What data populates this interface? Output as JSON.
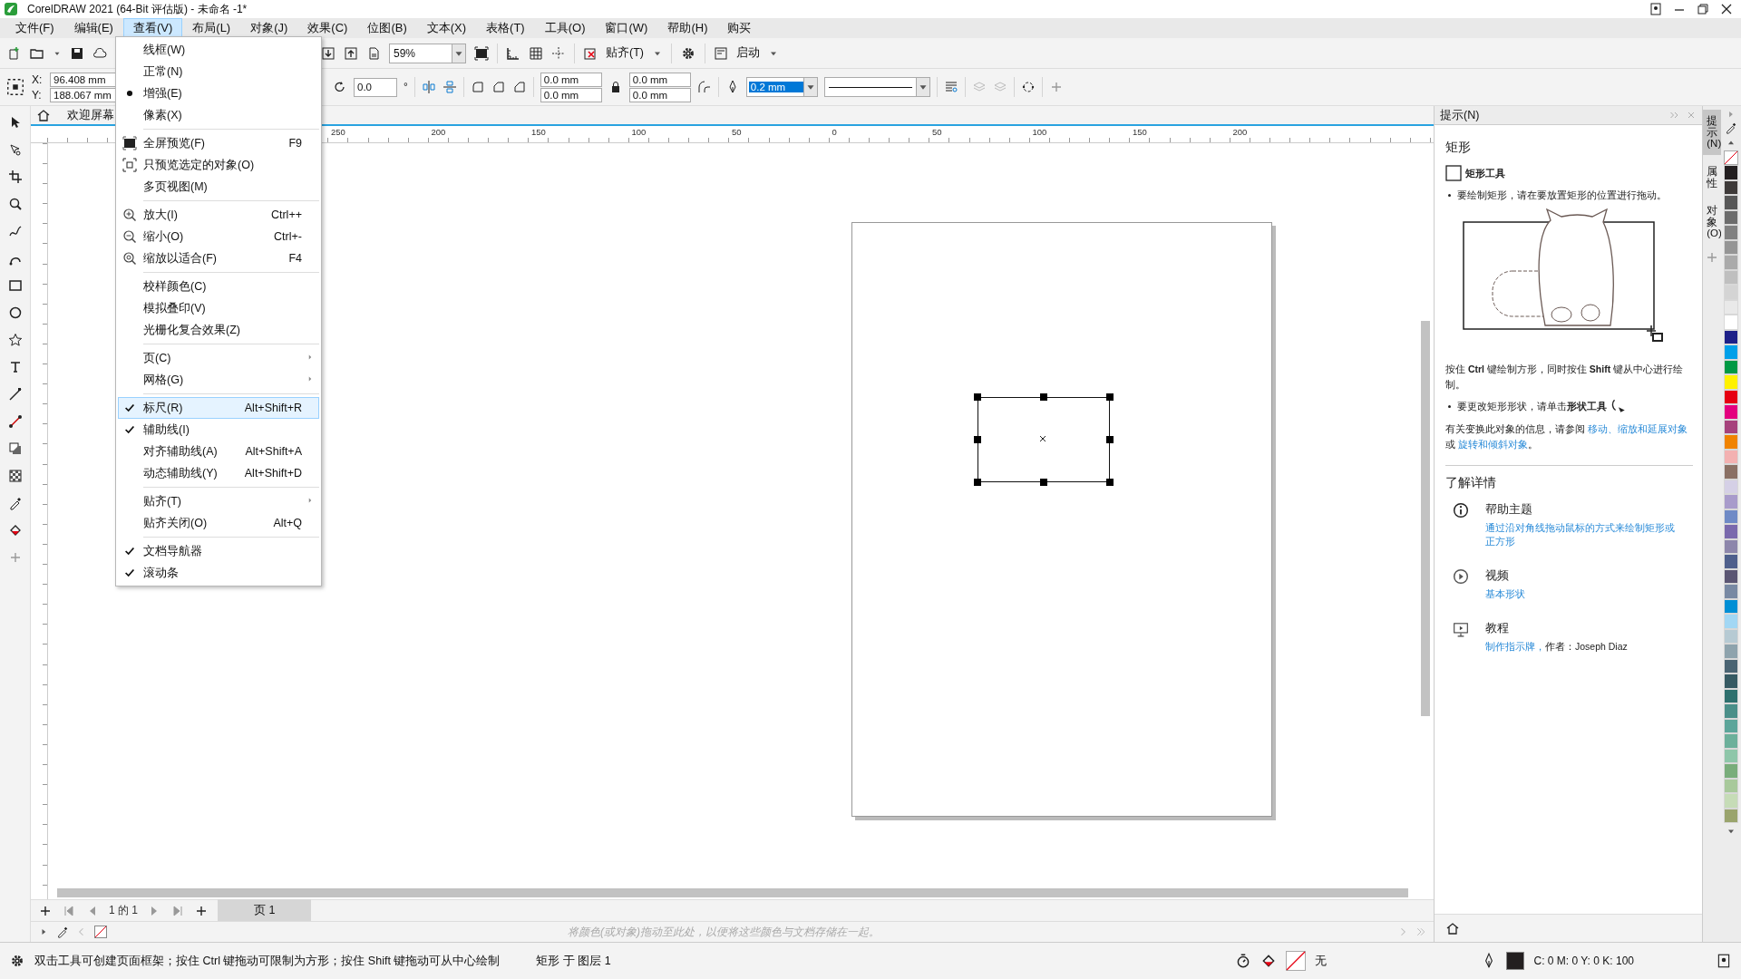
{
  "window": {
    "title": "CorelDRAW 2021 (64-Bit 评估版) - 未命名 -1*"
  },
  "menu_bar": [
    {
      "label": "文件(F)",
      "selected": false
    },
    {
      "label": "编辑(E)",
      "selected": false
    },
    {
      "label": "查看(V)",
      "selected": true
    },
    {
      "label": "布局(L)",
      "selected": false
    },
    {
      "label": "对象(J)",
      "selected": false
    },
    {
      "label": "效果(C)",
      "selected": false
    },
    {
      "label": "位图(B)",
      "selected": false
    },
    {
      "label": "文本(X)",
      "selected": false
    },
    {
      "label": "表格(T)",
      "selected": false
    },
    {
      "label": "工具(O)",
      "selected": false
    },
    {
      "label": "窗口(W)",
      "selected": false
    },
    {
      "label": "帮助(H)",
      "selected": false
    },
    {
      "label": "购买",
      "selected": false
    }
  ],
  "toolbar": {
    "zoom": "59%",
    "snap": "贴齐(T)",
    "launch": "启动"
  },
  "property_bar": {
    "x_label": "X:",
    "x": "96.408 mm",
    "y_label": "Y:",
    "y": "188.067 mm",
    "rotation": "0.0",
    "degree": "°",
    "width_1": "0.0 mm",
    "width_2": "0.0 mm",
    "width_3": "0.0 mm",
    "width_4": "0.0 mm",
    "outline_width": "0.2 mm"
  },
  "view_menu": [
    {
      "kind": "radio",
      "items": [
        {
          "label": "线框(W)",
          "checked": false,
          "selected": false
        },
        {
          "label": "正常(N)",
          "checked": false,
          "selected": false
        },
        {
          "label": "增强(E)",
          "checked": true,
          "selected": false
        },
        {
          "label": "像素(X)",
          "checked": false,
          "selected": false
        }
      ]
    },
    {
      "items": [
        {
          "label": "全屏预览(F)",
          "shortcut": "F9",
          "checked": false,
          "selected": false
        },
        {
          "label": "只预览选定的对象(O)",
          "checked": false,
          "selected": false
        },
        {
          "label": "多页视图(M)",
          "checked": false,
          "selected": false
        }
      ]
    },
    {
      "items": [
        {
          "label": "放大(I)",
          "shortcut": "Ctrl++",
          "checked": false,
          "selected": false
        },
        {
          "label": "缩小(O)",
          "shortcut": "Ctrl+-",
          "checked": false,
          "selected": false
        },
        {
          "label": "缩放以适合(F)",
          "shortcut": "F4",
          "checked": false,
          "selected": false
        }
      ]
    },
    {
      "items": [
        {
          "label": "校样颜色(C)",
          "checked": false,
          "selected": false
        },
        {
          "label": "模拟叠印(V)",
          "checked": false,
          "selected": false
        },
        {
          "label": "光栅化复合效果(Z)",
          "checked": false,
          "selected": false
        }
      ]
    },
    {
      "items": [
        {
          "label": "页(C)",
          "submenu": true,
          "checked": false,
          "selected": false
        },
        {
          "label": "网格(G)",
          "submenu": true,
          "checked": false,
          "selected": false
        }
      ]
    },
    {
      "kind": "check",
      "items": [
        {
          "label": "标尺(R)",
          "shortcut": "Alt+Shift+R",
          "checked": true,
          "selected": true
        },
        {
          "label": "辅助线(I)",
          "checked": true,
          "selected": false
        },
        {
          "label": "对齐辅助线(A)",
          "shortcut": "Alt+Shift+A",
          "checked": false,
          "selected": false
        },
        {
          "label": "动态辅助线(Y)",
          "shortcut": "Alt+Shift+D",
          "checked": false,
          "selected": false
        }
      ]
    },
    {
      "items": [
        {
          "label": "贴齐(T)",
          "submenu": true,
          "checked": false,
          "selected": false
        },
        {
          "label": "贴齐关闭(O)",
          "shortcut": "Alt+Q",
          "checked": false,
          "selected": false
        }
      ]
    },
    {
      "kind": "check",
      "items": [
        {
          "label": "文档导航器",
          "checked": true,
          "selected": false
        },
        {
          "label": "滚动条",
          "checked": true,
          "selected": false
        }
      ]
    }
  ],
  "document_tab": "欢迎屏幕",
  "ruler_labels": [
    "250",
    "200",
    "150",
    "100",
    "50",
    "0",
    "50",
    "100",
    "150",
    "200"
  ],
  "page_navigator": {
    "position": "1 的 1",
    "page_tab": "页 1"
  },
  "color_bar_hint": "将颜色(或对象)拖动至此处，以便将这些颜色与文档存储在一起。",
  "docker": {
    "title": "提示(N)",
    "heading": "矩形",
    "tool": "矩形工具",
    "bullet_1": "要绘制矩形，请在要放置矩形的位置进行拖动。",
    "note": "按住 **Ctrl** 键绘制方形，同时按住 **Shift** 键从中心进行绘制。",
    "bullet_2": "要更改矩形形状，请单击**形状工具**",
    "see_also": {
      "before": "有关变换此对象的信息，请参阅 ",
      "links": [
        "移动、缩放和延展对象",
        "旋转和倾斜对象"
      ],
      "between": " 或 ",
      "after": "。"
    },
    "learn_more": "了解详情",
    "resources": [
      {
        "kind": "help",
        "title": "帮助主题",
        "link": "通过沿对角线拖动鼠标的方式来绘制矩形或正方形"
      },
      {
        "kind": "video",
        "title": "视频",
        "link": "基本形状"
      },
      {
        "kind": "tutorial",
        "title": "教程",
        "link": "制作指示牌，",
        "author": "作者：Joseph Diaz"
      }
    ]
  },
  "docker_tabs": [
    {
      "label": "提示(N)",
      "selected": true
    },
    {
      "label": "属性",
      "selected": false
    },
    {
      "label": "对象 (O)",
      "selected": false
    }
  ],
  "palette": [
    {
      "color": "#231f20"
    },
    {
      "color": "#3e3a39"
    },
    {
      "color": "#575757"
    },
    {
      "color": "#6c6c6c"
    },
    {
      "color": "#818181"
    },
    {
      "color": "#959595"
    },
    {
      "color": "#aaaaaa"
    },
    {
      "color": "#bfbfbf"
    },
    {
      "color": "#d4d4d4"
    },
    {
      "color": "#e9e9e9"
    },
    {
      "color": "#ffffff"
    },
    {
      "color": "#1d2088"
    },
    {
      "color": "#00a0e9"
    },
    {
      "color": "#009944"
    },
    {
      "color": "#fff100"
    },
    {
      "color": "#e60012"
    },
    {
      "color": "#e4007f"
    },
    {
      "color": "#a6427c"
    },
    {
      "color": "#f08300"
    },
    {
      "color": "#f3b1b1"
    },
    {
      "color": "#8a7064"
    },
    {
      "color": "#d5d0e6"
    },
    {
      "color": "#a89bcb"
    },
    {
      "color": "#6f8ac6"
    },
    {
      "color": "#7a69ad"
    },
    {
      "color": "#8d86ab"
    },
    {
      "color": "#4e5f8c"
    },
    {
      "color": "#5b5673"
    },
    {
      "color": "#7889a3"
    },
    {
      "color": "#008fd5"
    },
    {
      "color": "#a2d7f4"
    },
    {
      "color": "#b6cad3"
    },
    {
      "color": "#8ea3ad"
    },
    {
      "color": "#4a6473"
    },
    {
      "color": "#365a63"
    },
    {
      "color": "#2e706e"
    },
    {
      "color": "#4a8f89"
    },
    {
      "color": "#5ca59a"
    },
    {
      "color": "#6cb09b"
    },
    {
      "color": "#8ec6a9"
    },
    {
      "color": "#79ad7b"
    },
    {
      "color": "#a8c99b"
    },
    {
      "color": "#c6dcb7"
    },
    {
      "color": "#9aa46d"
    }
  ],
  "status_bar": {
    "hint": "双击工具可创建页面框架；按住 Ctrl 键拖动可限制为方形；按住 Shift 键拖动可从中心绘制",
    "selection": "矩形 于 图层 1",
    "fill_text": "无",
    "outline": {
      "color": "#231f20",
      "text": "C:  0 M:  0 Y:  0 K:  100"
    }
  }
}
